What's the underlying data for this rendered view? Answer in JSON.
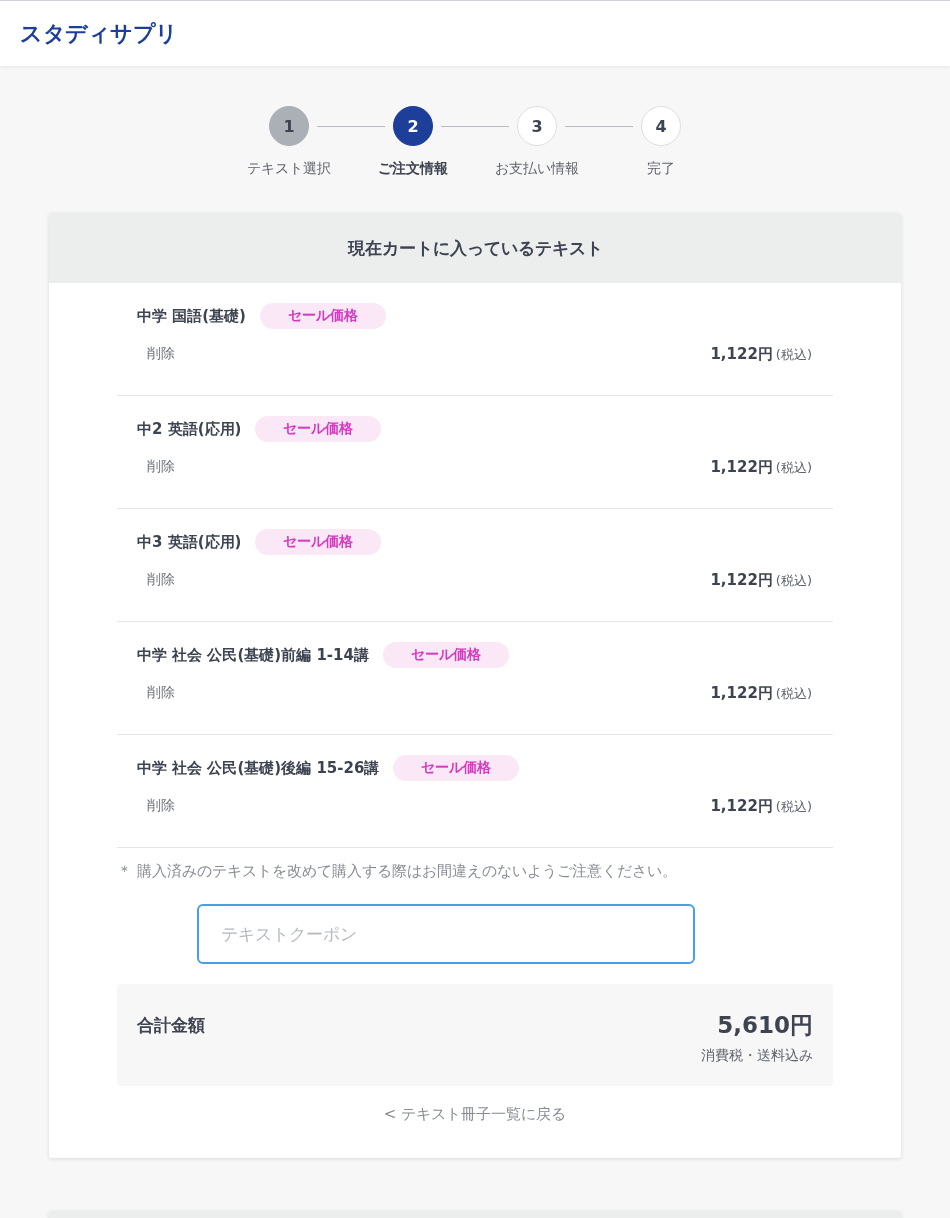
{
  "header": {
    "logo": "スタディサプリ"
  },
  "steps": [
    {
      "number": "1",
      "label": "テキスト選択",
      "completed": true,
      "selected": false
    },
    {
      "number": "2",
      "label": "ご注文情報",
      "completed": false,
      "selected": true
    },
    {
      "number": "3",
      "label": "お支払い情報",
      "completed": false,
      "selected": false
    },
    {
      "number": "4",
      "label": "完了",
      "completed": false,
      "selected": false
    }
  ],
  "cart": {
    "title": "現在カートに入っているテキスト",
    "items": [
      {
        "name": "中学 国語(基礎)",
        "badge": "セール価格",
        "remove": "削除",
        "price": "1,122円",
        "tax_note": "(税込)"
      },
      {
        "name": "中2 英語(応用)",
        "badge": "セール価格",
        "remove": "削除",
        "price": "1,122円",
        "tax_note": "(税込)"
      },
      {
        "name": "中3 英語(応用)",
        "badge": "セール価格",
        "remove": "削除",
        "price": "1,122円",
        "tax_note": "(税込)"
      },
      {
        "name": "中学 社会 公民(基礎)前編 1-14講",
        "badge": "セール価格",
        "remove": "削除",
        "price": "1,122円",
        "tax_note": "(税込)"
      },
      {
        "name": "中学 社会 公民(基礎)後編 15-26講",
        "badge": "セール価格",
        "remove": "削除",
        "price": "1,122円",
        "tax_note": "(税込)"
      }
    ],
    "note": "＊ 購入済みのテキストを改めて購入する際はお間違えのないようご注意ください。",
    "coupon": {
      "placeholder": "テキストクーポン"
    },
    "total": {
      "label": "合計金額",
      "amount": "5,610円",
      "note": "消費税・送料込み"
    },
    "back_link": "< テキスト冊子一覧に戻る"
  }
}
